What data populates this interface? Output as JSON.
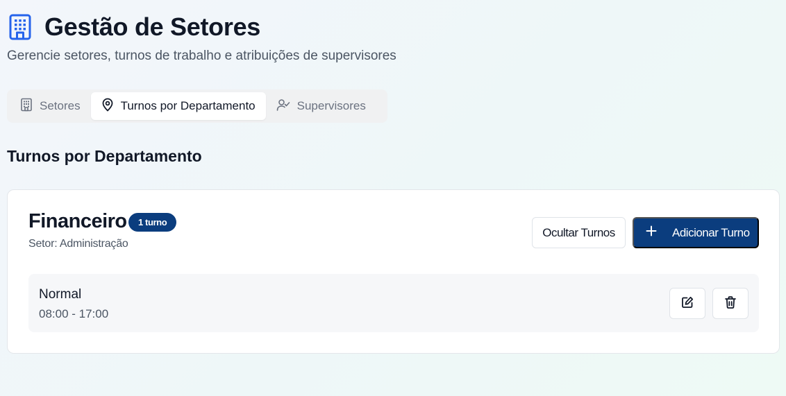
{
  "header": {
    "title": "Gestão de Setores",
    "subtitle": "Gerencie setores, turnos de trabalho e atribuições de supervisores",
    "icon": "building-icon"
  },
  "tabs": [
    {
      "label": "Setores",
      "icon": "building-icon",
      "active": false
    },
    {
      "label": "Turnos por Departamento",
      "icon": "map-pin-icon",
      "active": true
    },
    {
      "label": "Supervisores",
      "icon": "user-check-icon",
      "active": false
    }
  ],
  "section": {
    "title": "Turnos por Departamento"
  },
  "department": {
    "name": "Financeiro",
    "badge": "1 turno",
    "sector": "Setor: Administração",
    "hide_button": "Ocultar Turnos",
    "add_button": "Adicionar Turno",
    "shifts": [
      {
        "name": "Normal",
        "time": "08:00 - 17:00"
      }
    ]
  },
  "colors": {
    "primary": "#0b3d7e",
    "title_icon": "#2563eb",
    "text": "#111827",
    "muted": "#4b5563"
  }
}
